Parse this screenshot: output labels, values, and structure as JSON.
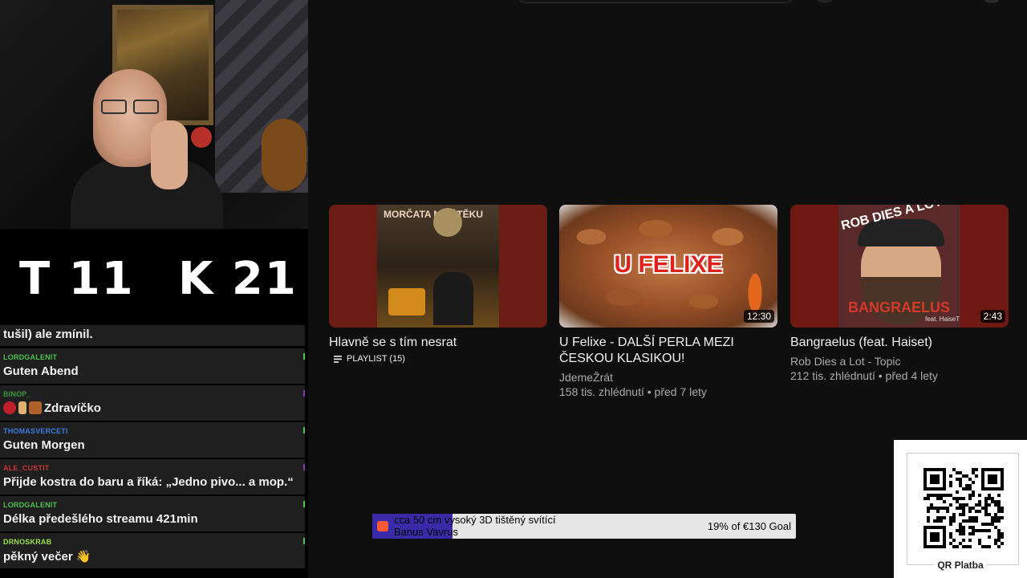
{
  "counters": {
    "t": "T 11",
    "k": "K 21"
  },
  "chat": [
    {
      "user": "",
      "text": "tušil) ale zmínil.",
      "user_color": "#ffffff",
      "tick_color": ""
    },
    {
      "user": "LORDGALENIT",
      "text": "Guten Abend",
      "user_color": "#4fc24f",
      "tick_color": "#4fc24f"
    },
    {
      "user": "BINOP_",
      "text": "Zdravíčko",
      "user_color": "#3a9a3a",
      "tick_color": "#8a3ab8"
    },
    {
      "user": "THOMASVERCETI",
      "text": "Guten Morgen",
      "user_color": "#3a7be0",
      "tick_color": "#4fc24f"
    },
    {
      "user": "ALE_CUSTIT",
      "text": "Přijde kostra do baru a říká: „Jedno pivo... a mop.“",
      "user_color": "#c83232",
      "tick_color": "#8a3ab8"
    },
    {
      "user": "LORDGALENIT",
      "text": "Délka předešlého streamu 421min",
      "user_color": "#4fc24f",
      "tick_color": "#4fc24f"
    },
    {
      "user": "DRNOSKRAB",
      "text": "pěkný večer 👋",
      "user_color": "#9be04f",
      "tick_color": "#4fc24f"
    }
  ],
  "videos": [
    {
      "title": "Hlavně se s tím nesrat",
      "playlist_label": "PLAYLIST (15)",
      "thumb_text": "MORČATA NA ÚTĚKU",
      "icon": "playlist-icon"
    },
    {
      "title": "U Felixe - DALŠÍ PERLA MEZI ČESKOU KLASIKOU!",
      "channel": "JdemeŽrát",
      "meta": "158 tis. zhlédnutí • před 7 lety",
      "duration": "12:30",
      "thumb_text": "U FELIXE"
    },
    {
      "title": "Bangraelus (feat. Haiset)",
      "channel": "Rob Dies a Lot - Topic",
      "meta": "212 tis. zhlédnutí • před 4 lety",
      "duration": "2:43",
      "thumb_top": "ROB DIES A LOT",
      "thumb_bottom": "BANGRAELUS",
      "thumb_feat": "feat. HaiseT"
    }
  ],
  "goal": {
    "line1": "cca 50 cm vysoký 3D tištěný svítící",
    "line2": "Banus Vavrus",
    "progress_text": "19% of €130 Goal",
    "progress": 0.19,
    "icon": "cup-icon"
  },
  "qr": {
    "label": "QR Platba"
  },
  "colors": {
    "fill": "#3a2aa8",
    "bg": "#0f0f0f",
    "chat_bg": "#1f1f1f"
  }
}
